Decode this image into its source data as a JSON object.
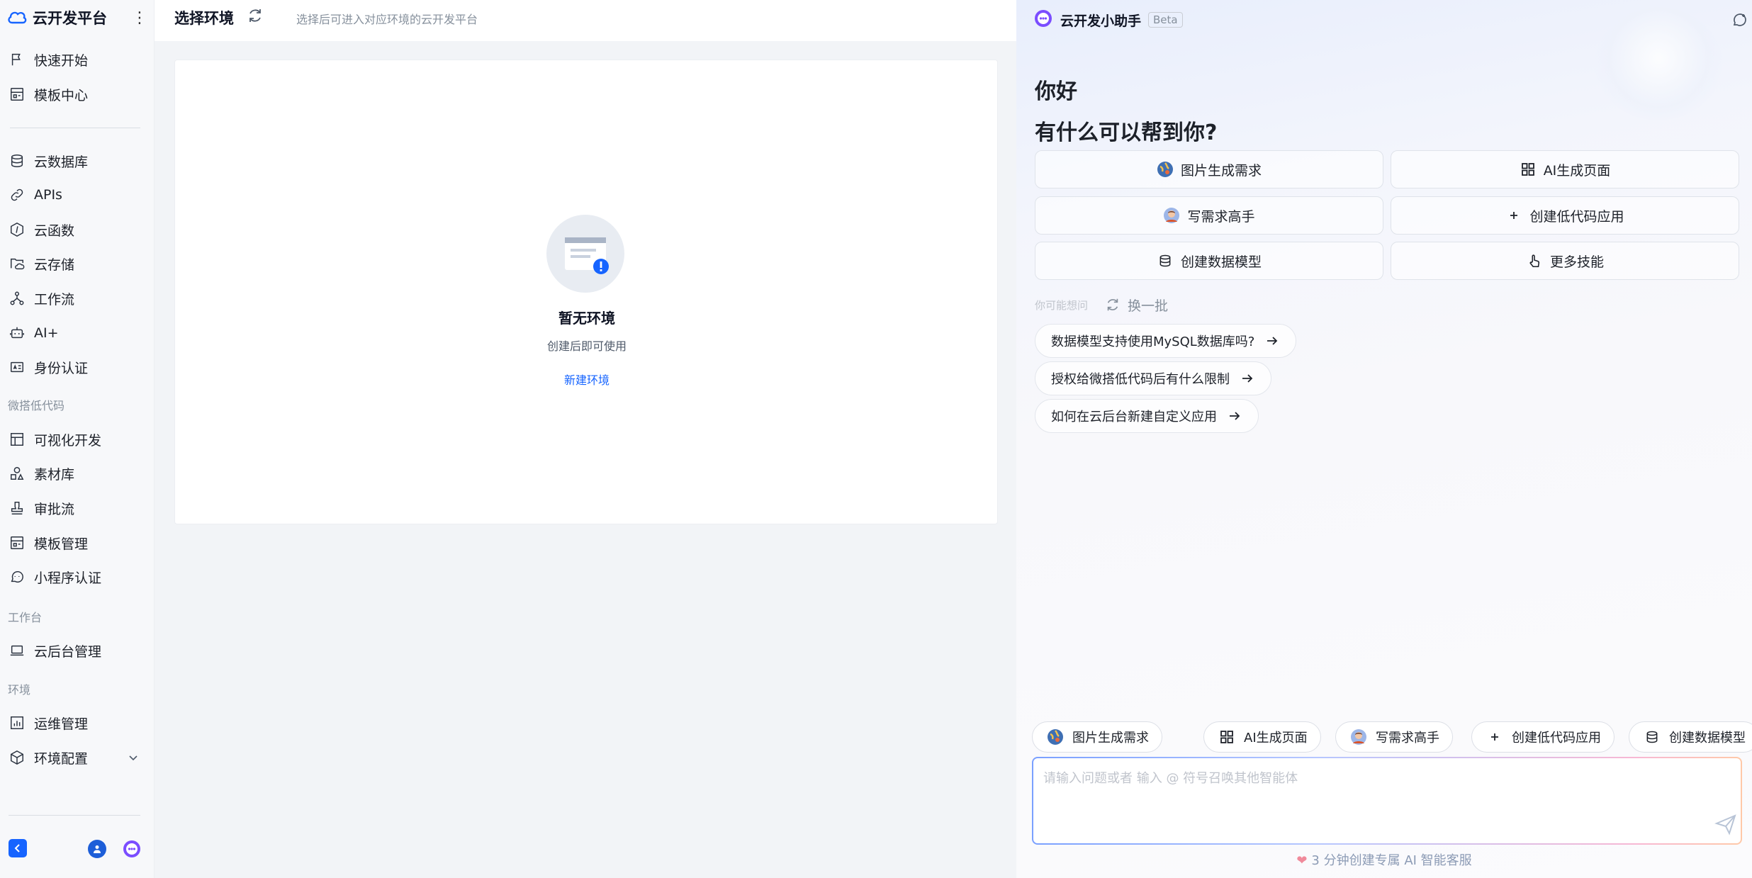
{
  "sidebar": {
    "brand": "云开发平台",
    "items": [
      {
        "label": "快速开始",
        "icon": "flag-icon"
      },
      {
        "label": "模板中心",
        "icon": "template-icon"
      },
      {
        "label": "云数据库",
        "icon": "database-icon"
      },
      {
        "label": "APIs",
        "icon": "link-icon"
      },
      {
        "label": "云函数",
        "icon": "function-icon"
      },
      {
        "label": "云存储",
        "icon": "folder-cloud-icon"
      },
      {
        "label": "工作流",
        "icon": "workflow-icon"
      },
      {
        "label": "AI+",
        "icon": "robot-icon"
      },
      {
        "label": "身份认证",
        "icon": "id-card-icon"
      },
      {
        "label": "可视化开发",
        "icon": "layout-icon"
      },
      {
        "label": "素材库",
        "icon": "materials-icon"
      },
      {
        "label": "审批流",
        "icon": "stamp-icon"
      },
      {
        "label": "模板管理",
        "icon": "template-manage-icon"
      },
      {
        "label": "小程序认证",
        "icon": "miniprogram-icon"
      },
      {
        "label": "云后台管理",
        "icon": "laptop-icon"
      },
      {
        "label": "运维管理",
        "icon": "chart-icon"
      },
      {
        "label": "环境配置",
        "icon": "settings-cube-icon"
      }
    ],
    "groups": {
      "lowcode": "微搭低代码",
      "workbench": "工作台",
      "env": "环境"
    }
  },
  "main": {
    "title": "选择环境",
    "subtitle": "选择后可进入对应环境的云开发平台",
    "empty_title": "暂无环境",
    "empty_sub": "创建后即可使用",
    "create_link": "新建环境"
  },
  "assistant": {
    "title": "云开发小助手",
    "beta": "Beta",
    "greeting": "你好",
    "ask": "有什么可以帮到你?",
    "skills": [
      {
        "label": "图片生成需求",
        "icon": "globe-avatar-icon"
      },
      {
        "label": "AI生成页面",
        "icon": "grid-icon"
      },
      {
        "label": "写需求高手",
        "icon": "person-avatar-icon"
      },
      {
        "label": "创建低代码应用",
        "icon": "plus-icon"
      },
      {
        "label": "创建数据模型",
        "icon": "database-icon"
      },
      {
        "label": "更多技能",
        "icon": "pointer-icon"
      }
    ],
    "maybe_label": "你可能想问",
    "swap_label": "换一批",
    "questions": [
      "数据模型支持使用MySQL数据库吗?",
      "授权给微搭低代码后有什么限制",
      "如何在云后台新建自定义应用"
    ],
    "chips": [
      {
        "label": "图片生成需求",
        "icon": "globe-avatar-icon"
      },
      {
        "label": "AI生成页面",
        "icon": "grid-icon"
      },
      {
        "label": "写需求高手",
        "icon": "person-avatar-icon"
      },
      {
        "label": "创建低代码应用",
        "icon": "plus-icon"
      },
      {
        "label": "创建数据模型",
        "icon": "database-icon"
      }
    ],
    "input_placeholder": "请输入问题或者 输入 @ 符号召唤其他智能体",
    "promo": "3 分钟创建专属 AI 智能客服"
  },
  "colors": {
    "accent": "#1664ff",
    "muted": "#86909c"
  }
}
